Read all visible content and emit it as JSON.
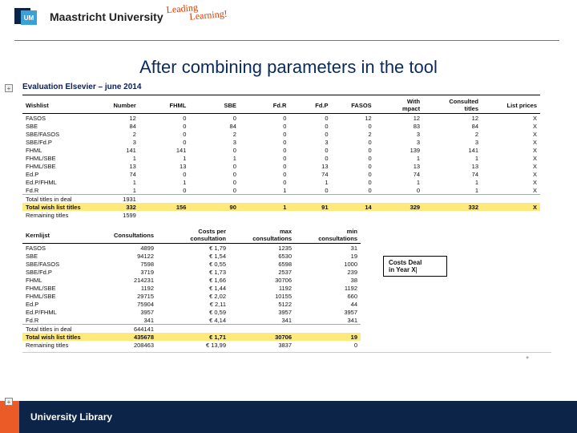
{
  "header": {
    "brand": "Maastricht University",
    "logo_letters": "UM",
    "tagline_l1": "Leading",
    "tagline_l2": "Learning!"
  },
  "title": "After combining parameters in the tool",
  "evaluation_title": "Evaluation Elsevier – june 2014",
  "columns_main": {
    "c0": "Wishlist",
    "c1": "Number",
    "c2": "FHML",
    "c3": "SBE",
    "c4": "Fd.R",
    "c5": "Fd.P",
    "c6": "FASOS",
    "c7_l1": "With",
    "c7_l2": "mpact",
    "c8_l1": "Consulted",
    "c8_l2": "titles",
    "c9": "List prices"
  },
  "rows_main": [
    {
      "label": "FASOS",
      "n": "12",
      "fhml": "0",
      "sbe": "0",
      "fdr": "0",
      "fdp": "0",
      "fasos": "12",
      "impact": "12",
      "cons": "12",
      "list": "X"
    },
    {
      "label": "SBE",
      "n": "84",
      "fhml": "0",
      "sbe": "84",
      "fdr": "0",
      "fdp": "0",
      "fasos": "0",
      "impact": "83",
      "cons": "84",
      "list": "X"
    },
    {
      "label": "SBE/FASOS",
      "n": "2",
      "fhml": "0",
      "sbe": "2",
      "fdr": "0",
      "fdp": "0",
      "fasos": "2",
      "impact": "3",
      "cons": "2",
      "list": "X"
    },
    {
      "label": "SBE/Fd.P",
      "n": "3",
      "fhml": "0",
      "sbe": "3",
      "fdr": "0",
      "fdp": "3",
      "fasos": "0",
      "impact": "3",
      "cons": "3",
      "list": "X"
    },
    {
      "label": "FHML",
      "n": "141",
      "fhml": "141",
      "sbe": "0",
      "fdr": "0",
      "fdp": "0",
      "fasos": "0",
      "impact": "139",
      "cons": "141",
      "list": "X"
    },
    {
      "label": "FHML/SBE",
      "n": "1",
      "fhml": "1",
      "sbe": "1",
      "fdr": "0",
      "fdp": "0",
      "fasos": "0",
      "impact": "1",
      "cons": "1",
      "list": "X"
    },
    {
      "label": "FHML/SBE",
      "n": "13",
      "fhml": "13",
      "sbe": "0",
      "fdr": "0",
      "fdp": "13",
      "fasos": "0",
      "impact": "13",
      "cons": "13",
      "list": "X"
    },
    {
      "label": "Ed.P",
      "n": "74",
      "fhml": "0",
      "sbe": "0",
      "fdr": "0",
      "fdp": "74",
      "fasos": "0",
      "impact": "74",
      "cons": "74",
      "list": "X"
    },
    {
      "label": "Ed.P/FHML",
      "n": "1",
      "fhml": "1",
      "sbe": "0",
      "fdr": "0",
      "fdp": "1",
      "fasos": "0",
      "impact": "1",
      "cons": "1",
      "list": "X"
    },
    {
      "label": "Fd.R",
      "n": "1",
      "fhml": "0",
      "sbe": "0",
      "fdr": "1",
      "fdp": "0",
      "fasos": "0",
      "impact": "0",
      "cons": "1",
      "list": "X"
    }
  ],
  "totals_main": {
    "deal": {
      "label": "Total titles in deal",
      "n": "1931"
    },
    "wish": {
      "label": "Total wish list titles",
      "n": "332",
      "fhml": "156",
      "sbe": "90",
      "fdr": "1",
      "fdp": "91",
      "fasos": "14",
      "impact": "329",
      "cons": "332",
      "list": "X"
    },
    "rem": {
      "label": "Remaining titles",
      "n": "1599"
    }
  },
  "columns_kern": {
    "c0": "Kernlijst",
    "c1": "Consultations",
    "c2_l1": "Costs per",
    "c2_l2": "consultation",
    "c3_l1": "max",
    "c3_l2": "consultations",
    "c4_l1": "min",
    "c4_l2": "consultations"
  },
  "rows_kern": [
    {
      "label": "FASOS",
      "cons": "4899",
      "cpc": "€ 1,79",
      "max": "1235",
      "min": "31"
    },
    {
      "label": "SBE",
      "cons": "94122",
      "cpc": "€ 1,54",
      "max": "6530",
      "min": "19"
    },
    {
      "label": "SBE/FASOS",
      "cons": "7598",
      "cpc": "€ 0,55",
      "max": "6598",
      "min": "1000"
    },
    {
      "label": "SBE/Fd.P",
      "cons": "3719",
      "cpc": "€ 1,73",
      "max": "2537",
      "min": "239"
    },
    {
      "label": "FHML",
      "cons": "214231",
      "cpc": "€ 1,66",
      "max": "30706",
      "min": "38"
    },
    {
      "label": "FHML/SBE",
      "cons": "1192",
      "cpc": "€ 1,44",
      "max": "1192",
      "min": "1192"
    },
    {
      "label": "FHML/SBE",
      "cons": "29715",
      "cpc": "€ 2,02",
      "max": "10155",
      "min": "660"
    },
    {
      "label": "Ed.P",
      "cons": "75904",
      "cpc": "€ 2,11",
      "max": "5122",
      "min": "44"
    },
    {
      "label": "Ed.P/FHML",
      "cons": "3957",
      "cpc": "€ 0,59",
      "max": "3957",
      "min": "3957"
    },
    {
      "label": "Fd.R",
      "cons": "341",
      "cpc": "€ 4,14",
      "max": "341",
      "min": "341"
    }
  ],
  "totals_kern": {
    "deal": {
      "label": "Total titles in deal",
      "cons": "644141"
    },
    "wish": {
      "label": "Total wish list titles",
      "cons": "435678",
      "cpc": "€ 1,71",
      "max": "30706",
      "min": "19"
    },
    "rem": {
      "label": "Remaining titles",
      "cons": "208463",
      "cpc": "€ 13,99",
      "max": "3837",
      "min": "0"
    }
  },
  "costs_box": {
    "l1": "Costs Deal",
    "l2": "in Year X"
  },
  "footer": "University Library",
  "chart_data": [
    {
      "type": "table",
      "title": "Evaluation Elsevier – june 2014 — Wishlist counts",
      "columns": [
        "Wishlist",
        "Number",
        "FHML",
        "SBE",
        "Fd.R",
        "Fd.P",
        "FASOS",
        "With mpact",
        "Consulted titles",
        "List prices"
      ],
      "rows": [
        [
          "FASOS",
          12,
          0,
          0,
          0,
          0,
          12,
          12,
          12,
          "X"
        ],
        [
          "SBE",
          84,
          0,
          84,
          0,
          0,
          0,
          83,
          84,
          "X"
        ],
        [
          "SBE/FASOS",
          2,
          0,
          2,
          0,
          0,
          2,
          3,
          2,
          "X"
        ],
        [
          "SBE/Fd.P",
          3,
          0,
          3,
          0,
          3,
          0,
          3,
          3,
          "X"
        ],
        [
          "FHML",
          141,
          141,
          0,
          0,
          0,
          0,
          139,
          141,
          "X"
        ],
        [
          "FHML/SBE",
          1,
          1,
          1,
          0,
          0,
          0,
          1,
          1,
          "X"
        ],
        [
          "FHML/SBE",
          13,
          13,
          0,
          0,
          13,
          0,
          13,
          13,
          "X"
        ],
        [
          "Ed.P",
          74,
          0,
          0,
          0,
          74,
          0,
          74,
          74,
          "X"
        ],
        [
          "Ed.P/FHML",
          1,
          1,
          0,
          0,
          1,
          0,
          1,
          1,
          "X"
        ],
        [
          "Fd.R",
          1,
          0,
          0,
          1,
          0,
          0,
          0,
          1,
          "X"
        ],
        [
          "Total titles in deal",
          1931,
          null,
          null,
          null,
          null,
          null,
          null,
          null,
          null
        ],
        [
          "Total wish list titles",
          332,
          156,
          90,
          1,
          91,
          14,
          329,
          332,
          "X"
        ],
        [
          "Remaining titles",
          1599,
          null,
          null,
          null,
          null,
          null,
          null,
          null,
          null
        ]
      ]
    },
    {
      "type": "table",
      "title": "Kernlijst — consultations and costs",
      "columns": [
        "Kernlijst",
        "Consultations",
        "Costs per consultation (€)",
        "max consultations",
        "min consultations"
      ],
      "rows": [
        [
          "FASOS",
          4899,
          1.79,
          1235,
          31
        ],
        [
          "SBE",
          94122,
          1.54,
          6530,
          19
        ],
        [
          "SBE/FASOS",
          7598,
          0.55,
          6598,
          1000
        ],
        [
          "SBE/Fd.P",
          3719,
          1.73,
          2537,
          239
        ],
        [
          "FHML",
          214231,
          1.66,
          30706,
          38
        ],
        [
          "FHML/SBE",
          1192,
          1.44,
          1192,
          1192
        ],
        [
          "FHML/SBE",
          29715,
          2.02,
          10155,
          660
        ],
        [
          "Ed.P",
          75904,
          2.11,
          5122,
          44
        ],
        [
          "Ed.P/FHML",
          3957,
          0.59,
          3957,
          3957
        ],
        [
          "Fd.R",
          341,
          4.14,
          341,
          341
        ],
        [
          "Total titles in deal",
          644141,
          null,
          null,
          null
        ],
        [
          "Total wish list titles",
          435678,
          1.71,
          30706,
          19
        ],
        [
          "Remaining titles",
          208463,
          13.99,
          3837,
          0
        ]
      ]
    }
  ]
}
